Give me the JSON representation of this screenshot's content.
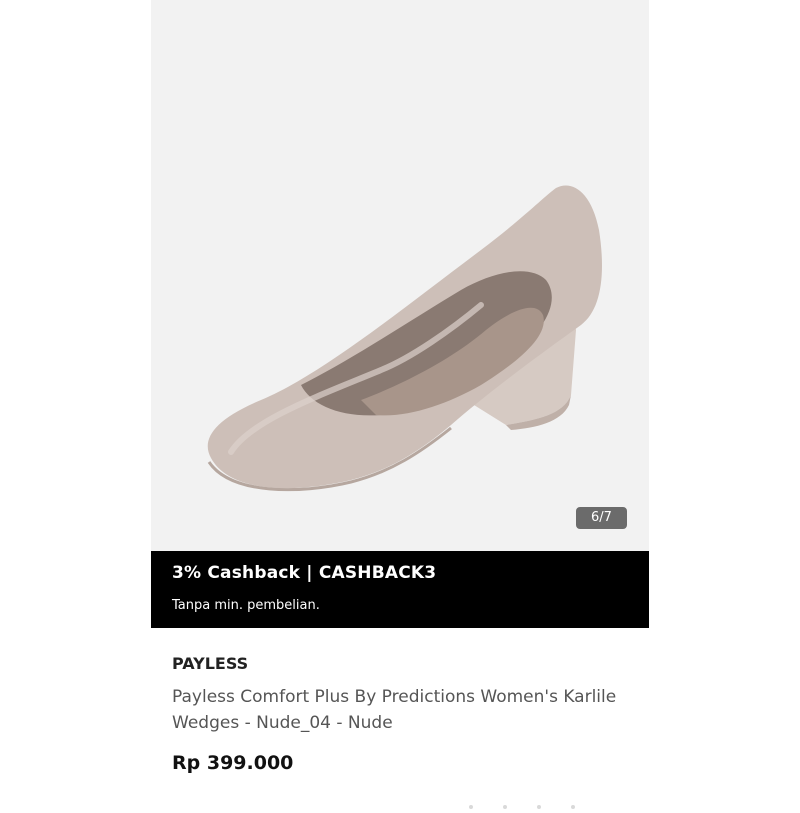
{
  "gallery": {
    "image": "nude-wedge-shoe-image",
    "counter": "6/7"
  },
  "promo": {
    "title": "3% Cashback | CASHBACK3",
    "subtitle": "Tanpa min. pembelian."
  },
  "product": {
    "brand": "PAYLESS",
    "title": "Payless Comfort Plus By Predictions Women's Karlile Wedges - Nude_04 - Nude",
    "price": "Rp 399.000"
  },
  "colors": {
    "promo_background": "#000000",
    "gallery_background": "#f2f2f2",
    "shoe": "#cdbfb8"
  }
}
